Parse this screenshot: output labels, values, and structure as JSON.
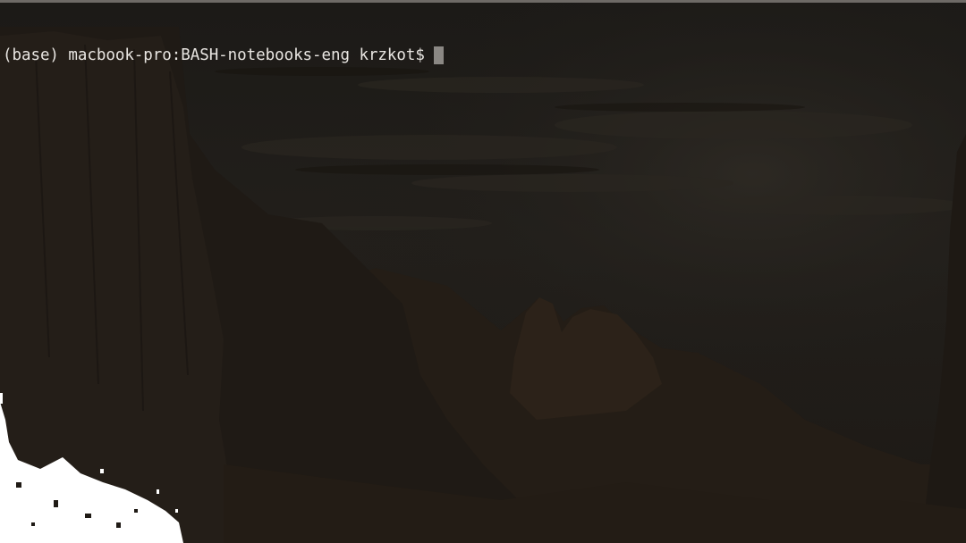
{
  "terminal": {
    "prompt_text": "(base) macbook-pro:BASH-notebooks-eng krzkot$",
    "input_value": "",
    "text_color": "#e9e6e2",
    "cursor_color": "#8b8884"
  },
  "wallpaper": {
    "description_icon": "mountain-valley-wallpaper",
    "base_color": "#1b1815"
  }
}
